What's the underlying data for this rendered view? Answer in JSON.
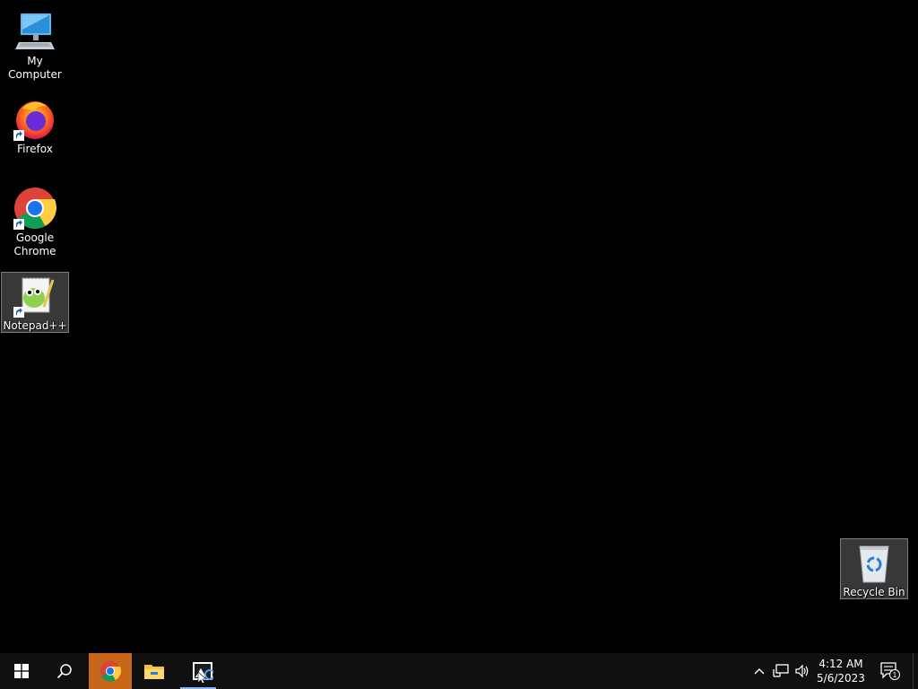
{
  "desktop": {
    "icons": [
      {
        "label": "My Computer",
        "icon": "computer-icon"
      },
      {
        "label": "Firefox",
        "icon": "firefox-icon"
      },
      {
        "label": "Google Chrome",
        "icon": "chrome-icon"
      },
      {
        "label": "Notepad++",
        "icon": "notepadpp-icon"
      },
      {
        "label": "Recycle Bin",
        "icon": "recycle-bin-icon"
      }
    ]
  },
  "taskbar": {
    "start_icon": "windows-start-icon",
    "search_icon": "search-icon",
    "apps": [
      {
        "name": "Google Chrome",
        "icon": "chrome-icon",
        "active": true
      },
      {
        "name": "File Explorer",
        "icon": "folder-icon",
        "active": false
      },
      {
        "name": "Image viewer",
        "icon": "image-app-icon",
        "active": false
      }
    ],
    "tray": {
      "overflow_icon": "chevron-up-icon",
      "network_icon": "network-icon",
      "volume_icon": "speaker-icon"
    },
    "clock": {
      "time": "4:12 AM",
      "date": "5/6/2023"
    },
    "notifications": {
      "icon": "notification-icon",
      "count": "1"
    }
  },
  "colors": {
    "desktop_bg": "#000000",
    "taskbar_bg": "#101010",
    "active_app": "#c8671a"
  }
}
